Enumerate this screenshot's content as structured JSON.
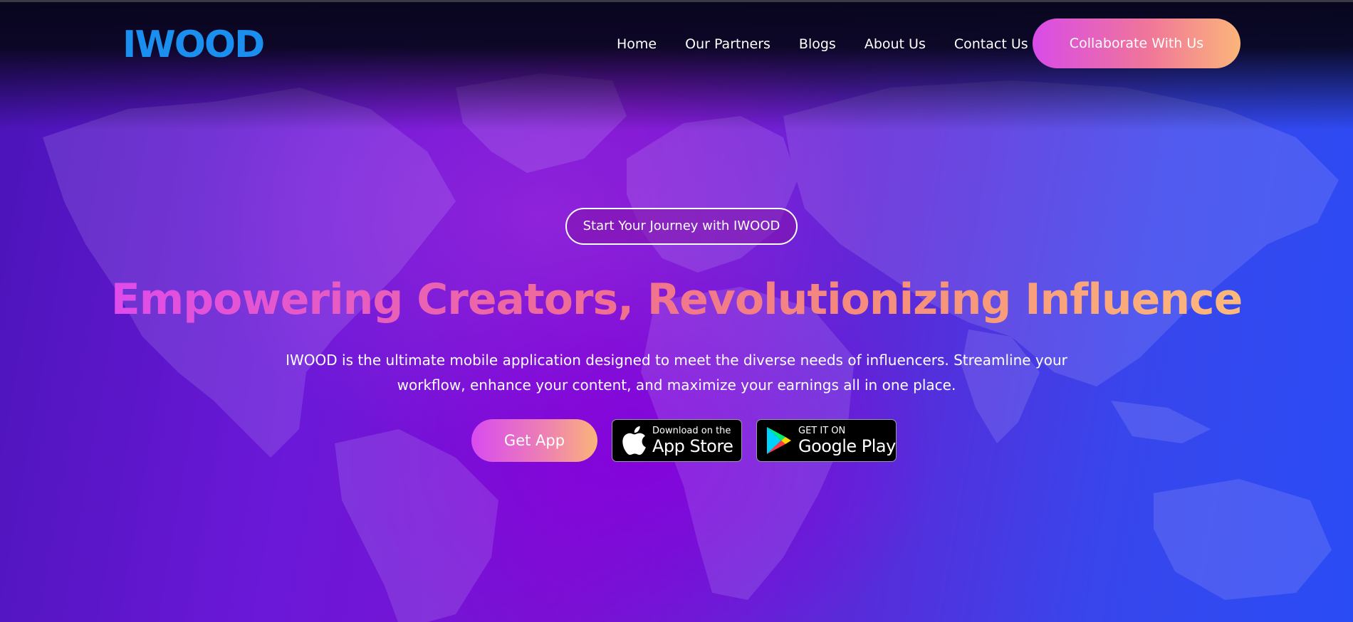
{
  "header": {
    "logo": "IWOOD",
    "nav": [
      {
        "label": "Home"
      },
      {
        "label": "Our Partners"
      },
      {
        "label": "Blogs"
      },
      {
        "label": "About Us"
      },
      {
        "label": "Contact Us"
      }
    ],
    "cta_label": "Collaborate With Us"
  },
  "hero": {
    "tagline": "Start Your Journey with IWOOD",
    "headline": "Empowering Creators, Revolutionizing Influence",
    "description": "IWOOD is the ultimate mobile application designed to meet the diverse needs of influencers. Streamline your workflow, enhance your content, and maximize your earnings all in one place.",
    "get_app_label": "Get App",
    "app_store": {
      "small": "Download on the",
      "big": "App Store",
      "icon": "apple-icon"
    },
    "google_play": {
      "small": "GET IT ON",
      "big": "Google Play",
      "icon": "google-play-icon"
    }
  },
  "colors": {
    "logo": "#1a8ff0",
    "gradient_start": "#d94be8",
    "gradient_end": "#fbb57a",
    "background_purple": "#7a12d2",
    "background_blue": "#2a4cf5"
  }
}
